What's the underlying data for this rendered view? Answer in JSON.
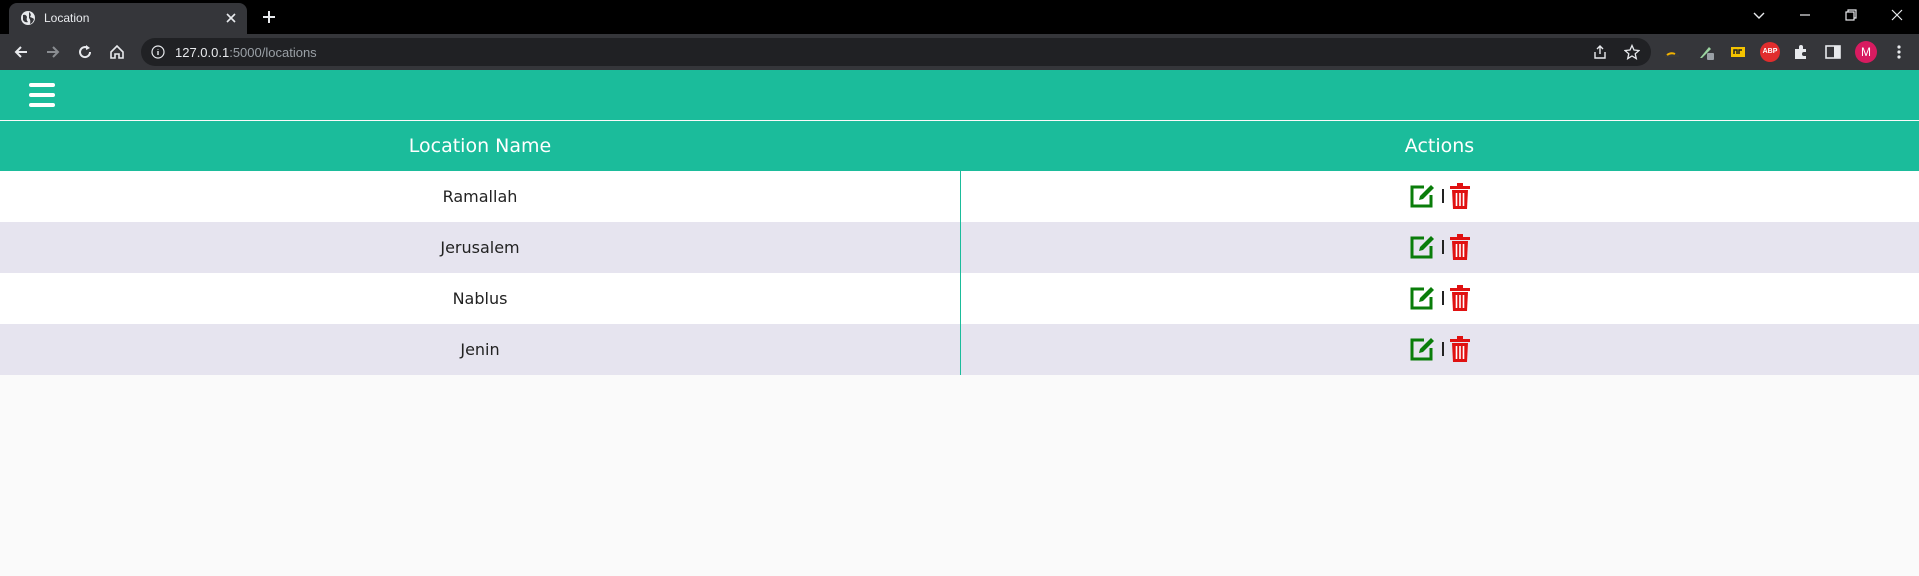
{
  "browser": {
    "tab_title": "Location",
    "url_host": "127.0.0.1",
    "url_rest": ":5000/locations",
    "profile_initial": "M",
    "extension_badge": "ABP"
  },
  "table": {
    "headers": [
      "Location Name",
      "Actions"
    ],
    "rows": [
      {
        "name": "Ramallah"
      },
      {
        "name": "Jerusalem"
      },
      {
        "name": "Nablus"
      },
      {
        "name": "Jenin"
      }
    ]
  },
  "colors": {
    "brand": "#1bbc9b",
    "edit": "#0a7d0a",
    "delete": "#e01111",
    "row_alt": "#e6e4ef"
  },
  "icons": [
    "globe-icon",
    "close-icon",
    "plus-icon",
    "back-arrow-icon",
    "forward-arrow-icon",
    "reload-icon",
    "home-icon",
    "info-icon",
    "share-icon",
    "star-icon",
    "puzzle-icon",
    "sidebar-icon",
    "menu-dots-icon",
    "hamburger-icon",
    "edit-icon",
    "trash-icon"
  ]
}
